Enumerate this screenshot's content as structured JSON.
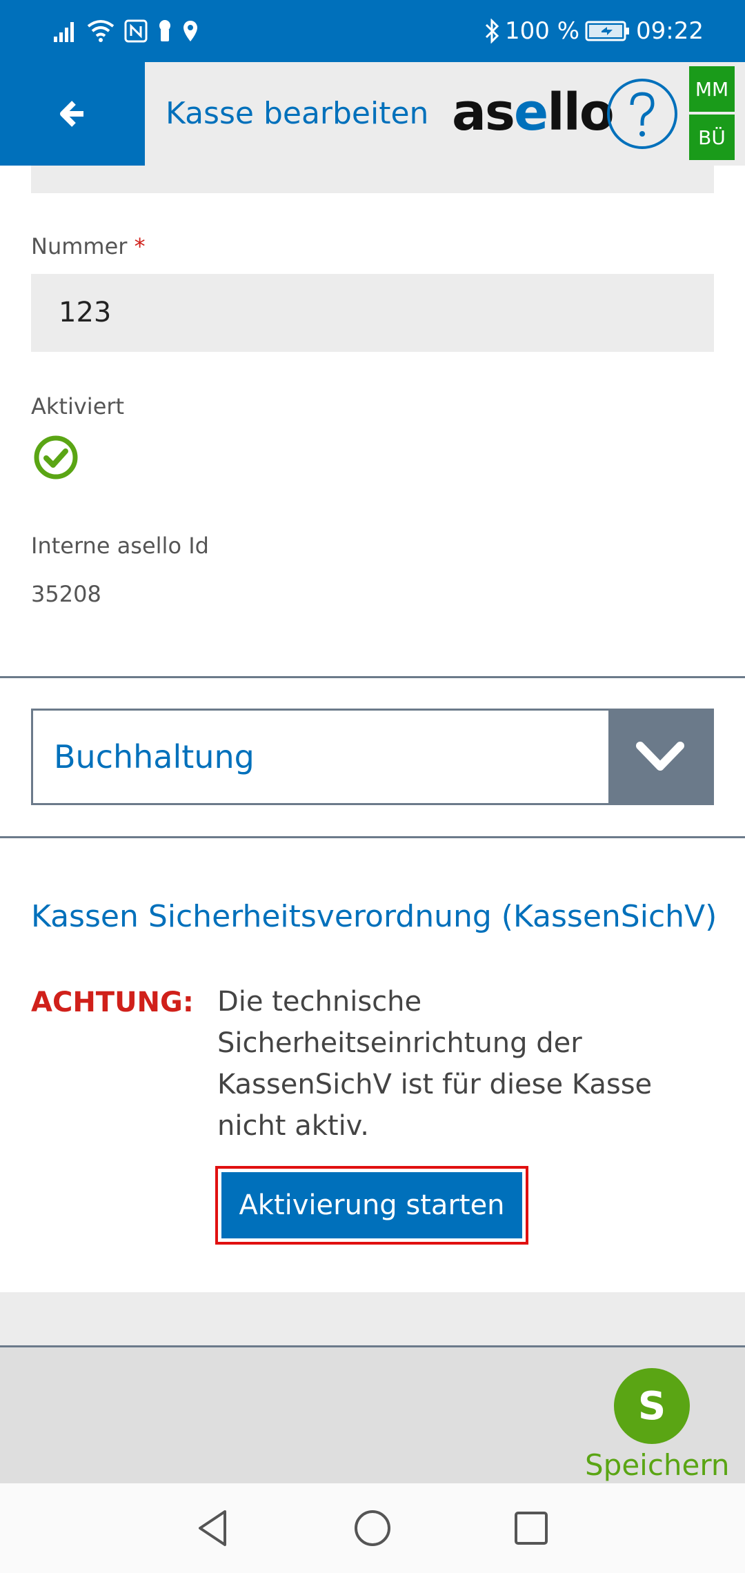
{
  "status_bar": {
    "battery": "100 %",
    "time": "09:22",
    "icons": [
      "signal-icon",
      "wifi-icon",
      "nfc-icon",
      "keyhole-icon",
      "location-icon",
      "bluetooth-icon",
      "battery-icon"
    ]
  },
  "app_bar": {
    "title": "Kasse bearbeiten",
    "logo": "asello",
    "user_badges": [
      "MM",
      "BÜ"
    ]
  },
  "form": {
    "nummer_label": "Nummer",
    "required_mark": "*",
    "nummer_value": "123",
    "aktiviert_label": "Aktiviert",
    "aktiviert": true,
    "interne_id_label": "Interne asello Id",
    "interne_id_value": "35208"
  },
  "accordion": {
    "label": "Buchhaltung"
  },
  "kassensichv": {
    "title": "Kassen Sicherheitsverordnung (KassenSichV)",
    "warning_label": "ACHTUNG:",
    "warning_text": "Die technische Sicherheitseinrichtung der KassenSichV ist für diese Kasse nicht aktiv.",
    "activate_button": "Aktivierung starten"
  },
  "footer": {
    "save_initial": "S",
    "save_label": "Speichern"
  },
  "colors": {
    "primary": "#0070bb",
    "warning": "#d0201a",
    "success": "#5aa514",
    "badge": "#1a9b1a",
    "accordion_toggle": "#6b7a8a"
  }
}
